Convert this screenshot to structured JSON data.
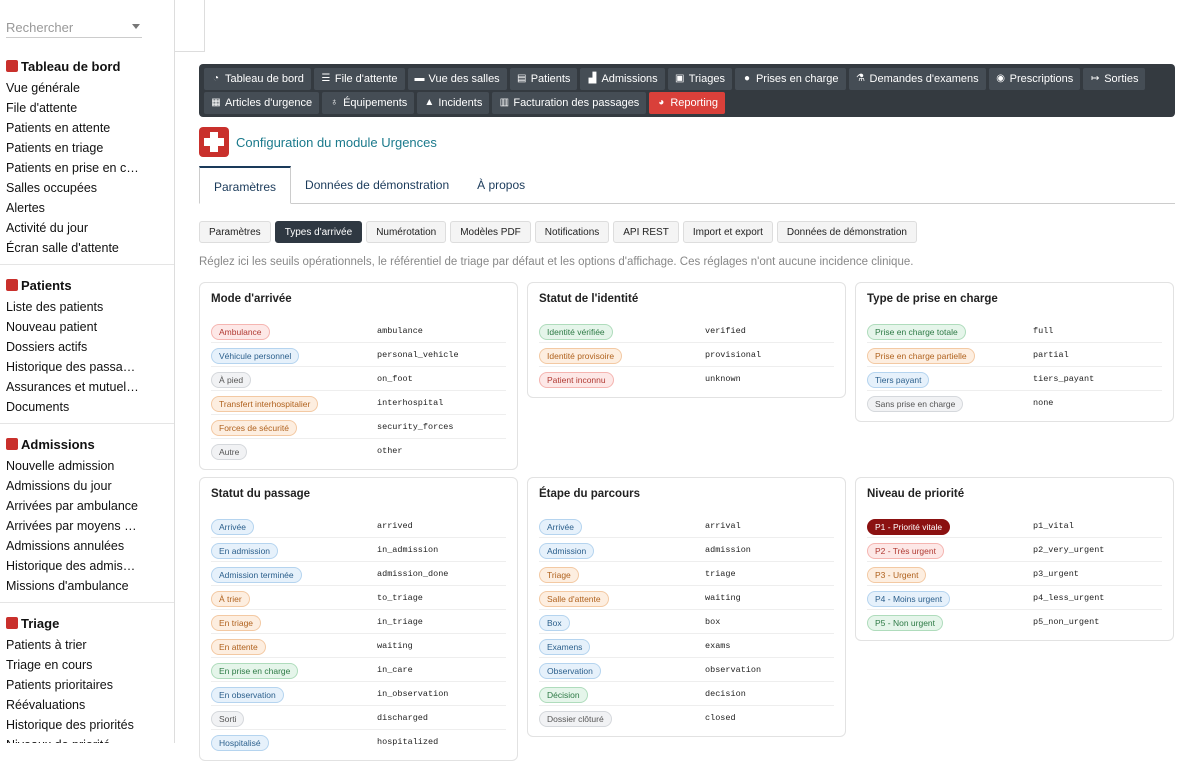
{
  "search": {
    "placeholder": "Rechercher"
  },
  "sidebar": [
    {
      "title": "Tableau de bord",
      "icon": "dashboard-icon",
      "color": "#c9302c",
      "items": [
        "Vue générale",
        "File d'attente",
        "Patients en attente",
        "Patients en triage",
        "Patients en prise en charge",
        "Salles occupées",
        "Alertes",
        "Activité du jour",
        "Écran salle d'attente"
      ]
    },
    {
      "title": "Patients",
      "icon": "id-card-icon",
      "color": "#c9302c",
      "items": [
        "Liste des patients",
        "Nouveau patient",
        "Dossiers actifs",
        "Historique des passages",
        "Assurances et mutuelles",
        "Documents"
      ]
    },
    {
      "title": "Admissions",
      "icon": "admission-icon",
      "color": "#c9302c",
      "items": [
        "Nouvelle admission",
        "Admissions du jour",
        "Arrivées par ambulance",
        "Arrivées par moyens pro…",
        "Admissions annulées",
        "Historique des admissions",
        "Missions d'ambulance"
      ]
    },
    {
      "title": "Triage",
      "icon": "clipboard-icon",
      "color": "#c9302c",
      "items": [
        "Patients à trier",
        "Triage en cours",
        "Patients prioritaires",
        "Réévaluations",
        "Historique des priorités",
        "Niveaux de priorité"
      ]
    }
  ],
  "nav": {
    "row1": [
      {
        "label": "Tableau de bord",
        "icon": "dashboard-icon",
        "glyph": "◔"
      },
      {
        "label": "File d'attente",
        "icon": "list-icon",
        "glyph": "☰"
      },
      {
        "label": "Vue des salles",
        "icon": "bed-icon",
        "glyph": "▬"
      },
      {
        "label": "Patients",
        "icon": "id-card-icon",
        "glyph": "▤"
      },
      {
        "label": "Admissions",
        "icon": "admission-icon",
        "glyph": "▟"
      },
      {
        "label": "Triages",
        "icon": "clipboard-icon",
        "glyph": "▣"
      },
      {
        "label": "Prises en charge",
        "icon": "user-doctor-icon",
        "glyph": "●"
      },
      {
        "label": "Demandes d'examens",
        "icon": "flask-icon",
        "glyph": "⚗"
      },
      {
        "label": "Prescriptions",
        "icon": "pills-icon",
        "glyph": "◉"
      },
      {
        "label": "Sorties",
        "icon": "sign-out-icon",
        "glyph": "↦"
      }
    ],
    "row2": [
      {
        "label": "Articles d'urgence",
        "icon": "boxes-icon",
        "glyph": "▦"
      },
      {
        "label": "Équipements",
        "icon": "stethoscope-icon",
        "glyph": "♁"
      },
      {
        "label": "Incidents",
        "icon": "warning-icon",
        "glyph": "▲"
      },
      {
        "label": "Facturation des passages",
        "icon": "invoice-icon",
        "glyph": "▥"
      },
      {
        "label": "Reporting",
        "icon": "chart-pie-icon",
        "glyph": "◕",
        "active": true
      }
    ]
  },
  "module": {
    "title": "Configuration du module Urgences"
  },
  "tabs": [
    "Paramètres",
    "Données de démonstration",
    "À propos"
  ],
  "subtabs": [
    "Paramètres",
    "Types d'arrivée",
    "Numérotation",
    "Modèles PDF",
    "Notifications",
    "API REST",
    "Import et export",
    "Données de démonstration"
  ],
  "intro": "Réglez ici les seuils opérationnels, le référentiel de triage par défaut et les options d'affichage. Ces réglages n'ont aucune incidence clinique.",
  "colors": {
    "red": {
      "bg": "#fde8e7",
      "border": "#f5b5b1",
      "text": "#b03a33"
    },
    "blue": {
      "bg": "#e6f1fb",
      "border": "#b5d4ef",
      "text": "#2b5f8c"
    },
    "grey": {
      "bg": "#f1f2f4",
      "border": "#d5d8dc",
      "text": "#555"
    },
    "orange": {
      "bg": "#fdeee0",
      "border": "#f3c9a3",
      "text": "#b0621e"
    },
    "green": {
      "bg": "#e5f5ea",
      "border": "#afdcbc",
      "text": "#2d7a45"
    },
    "darkred": {
      "bg": "#8b1111",
      "border": "#8b1111",
      "text": "#ffffff"
    }
  },
  "cards": [
    {
      "title": "Mode d'arrivée",
      "rows": [
        {
          "label": "Ambulance",
          "code": "ambulance",
          "color": "red"
        },
        {
          "label": "Véhicule personnel",
          "code": "personal_vehicle",
          "color": "blue"
        },
        {
          "label": "À pied",
          "code": "on_foot",
          "color": "grey"
        },
        {
          "label": "Transfert interhospitalier",
          "code": "interhospital",
          "color": "orange"
        },
        {
          "label": "Forces de sécurité",
          "code": "security_forces",
          "color": "orange"
        },
        {
          "label": "Autre",
          "code": "other",
          "color": "grey"
        }
      ]
    },
    {
      "title": "Statut de l'identité",
      "rows": [
        {
          "label": "Identité vérifiée",
          "code": "verified",
          "color": "green"
        },
        {
          "label": "Identité provisoire",
          "code": "provisional",
          "color": "orange"
        },
        {
          "label": "Patient inconnu",
          "code": "unknown",
          "color": "red"
        }
      ]
    },
    {
      "title": "Type de prise en charge",
      "rows": [
        {
          "label": "Prise en charge totale",
          "code": "full",
          "color": "green"
        },
        {
          "label": "Prise en charge partielle",
          "code": "partial",
          "color": "orange"
        },
        {
          "label": "Tiers payant",
          "code": "tiers_payant",
          "color": "blue"
        },
        {
          "label": "Sans prise en charge",
          "code": "none",
          "color": "grey"
        }
      ]
    },
    {
      "title": "Statut du passage",
      "rows": [
        {
          "label": "Arrivée",
          "code": "arrived",
          "color": "blue"
        },
        {
          "label": "En admission",
          "code": "in_admission",
          "color": "blue"
        },
        {
          "label": "Admission terminée",
          "code": "admission_done",
          "color": "blue"
        },
        {
          "label": "À trier",
          "code": "to_triage",
          "color": "orange"
        },
        {
          "label": "En triage",
          "code": "in_triage",
          "color": "orange"
        },
        {
          "label": "En attente",
          "code": "waiting",
          "color": "orange"
        },
        {
          "label": "En prise en charge",
          "code": "in_care",
          "color": "green"
        },
        {
          "label": "En observation",
          "code": "in_observation",
          "color": "blue"
        },
        {
          "label": "Sorti",
          "code": "discharged",
          "color": "grey"
        },
        {
          "label": "Hospitalisé",
          "code": "hospitalized",
          "color": "blue"
        }
      ]
    },
    {
      "title": "Étape du parcours",
      "rows": [
        {
          "label": "Arrivée",
          "code": "arrival",
          "color": "blue"
        },
        {
          "label": "Admission",
          "code": "admission",
          "color": "blue"
        },
        {
          "label": "Triage",
          "code": "triage",
          "color": "orange"
        },
        {
          "label": "Salle d'attente",
          "code": "waiting",
          "color": "orange"
        },
        {
          "label": "Box",
          "code": "box",
          "color": "blue"
        },
        {
          "label": "Examens",
          "code": "exams",
          "color": "blue"
        },
        {
          "label": "Observation",
          "code": "observation",
          "color": "blue"
        },
        {
          "label": "Décision",
          "code": "decision",
          "color": "green"
        },
        {
          "label": "Dossier clôturé",
          "code": "closed",
          "color": "grey"
        }
      ]
    },
    {
      "title": "Niveau de priorité",
      "rows": [
        {
          "label": "P1 - Priorité vitale",
          "code": "p1_vital",
          "color": "darkred"
        },
        {
          "label": "P2 - Très urgent",
          "code": "p2_very_urgent",
          "color": "red"
        },
        {
          "label": "P3 - Urgent",
          "code": "p3_urgent",
          "color": "orange"
        },
        {
          "label": "P4 - Moins urgent",
          "code": "p4_less_urgent",
          "color": "blue"
        },
        {
          "label": "P5 - Non urgent",
          "code": "p5_non_urgent",
          "color": "green"
        }
      ]
    }
  ]
}
